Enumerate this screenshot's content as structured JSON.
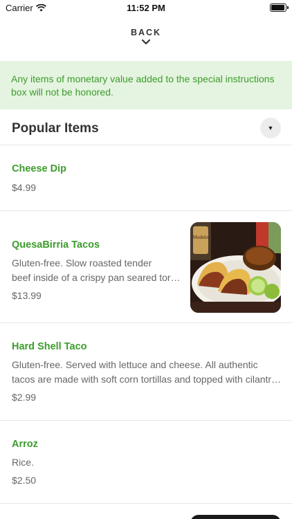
{
  "status": {
    "carrier": "Carrier",
    "time": "11:52 PM"
  },
  "nav": {
    "back_label": "BACK"
  },
  "notice": "Any items of monetary value added to the special instructions box will not be honored.",
  "section": {
    "title": "Popular Items"
  },
  "items": [
    {
      "name": "Cheese Dip",
      "price": "$4.99"
    },
    {
      "name": "QuesaBirria Tacos",
      "desc1": "Gluten-free. Slow roasted tender",
      "desc2": "beef inside of a crispy pan seared tortilla",
      "price": "$13.99",
      "image_label": "Modelo"
    },
    {
      "name": "Hard Shell Taco",
      "desc1": "Gluten-free. Served with lettuce and cheese. All authentic",
      "desc2": "tacos are made with soft corn tortillas and topped with cilantro and onion",
      "price": "$2.99"
    },
    {
      "name": "Arroz",
      "desc1": "Rice.",
      "price": "$2.50"
    }
  ],
  "colors": {
    "accent": "#3c9c2c",
    "notice_bg": "#e5f4e0"
  }
}
